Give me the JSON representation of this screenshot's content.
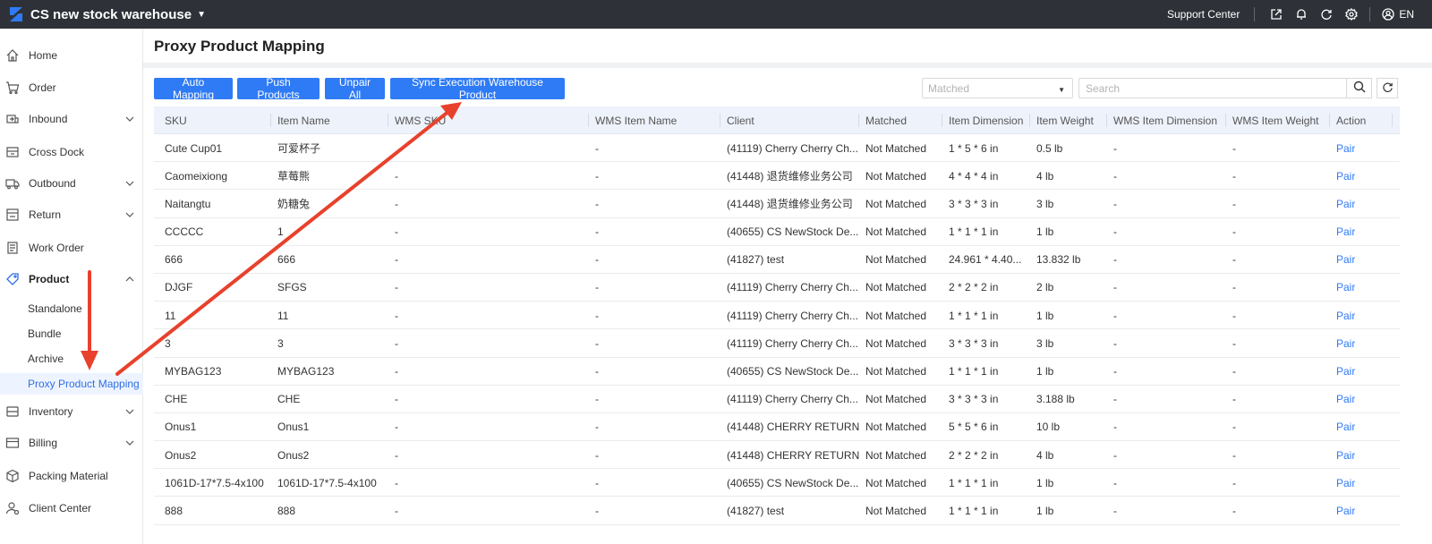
{
  "topbar": {
    "warehouse": "CS new stock warehouse",
    "support": "Support Center",
    "language": "EN",
    "icons": [
      "share-icon",
      "bell-icon",
      "refresh-icon",
      "settings-icon",
      "user-icon"
    ]
  },
  "sidebar": {
    "items": [
      {
        "label": "Home",
        "icon": "home-icon"
      },
      {
        "label": "Order",
        "icon": "cart-icon"
      },
      {
        "label": "Inbound",
        "icon": "inbound-icon"
      },
      {
        "label": "Cross Dock",
        "icon": "cross-dock-icon"
      },
      {
        "label": "Outbound",
        "icon": "truck-icon"
      },
      {
        "label": "Return",
        "icon": "return-icon"
      },
      {
        "label": "Work Order",
        "icon": "work-order-icon"
      },
      {
        "label": "Product",
        "icon": "tag-icon"
      },
      {
        "label": "Inventory",
        "icon": "inventory-icon"
      },
      {
        "label": "Billing",
        "icon": "billing-icon"
      },
      {
        "label": "Packing Material",
        "icon": "box-icon"
      },
      {
        "label": "Client Center",
        "icon": "client-icon"
      }
    ],
    "product_sub": [
      "Standalone",
      "Bundle",
      "Archive",
      "Proxy Product Mapping"
    ]
  },
  "page": {
    "title": "Proxy Product Mapping",
    "buttons": {
      "auto_mapping": "Auto Mapping",
      "push_products": "Push Products",
      "unpair_all": "Unpair All",
      "sync": "Sync Execution Warehouse Product"
    },
    "filter_placeholder": "Matched",
    "search_placeholder": "Search"
  },
  "table": {
    "columns": [
      "SKU",
      "Item Name",
      "WMS SKU",
      "WMS Item Name",
      "Client",
      "Matched",
      "Item Dimension",
      "Item Weight",
      "WMS Item Dimension",
      "WMS Item Weight",
      "Action"
    ],
    "rows": [
      [
        "Cute Cup01",
        "可爱杯子",
        "",
        "-",
        "(41119) Cherry Cherry Ch...",
        "Not Matched",
        "1 * 5 * 6 in",
        "0.5 lb",
        "-",
        "-",
        "Pair"
      ],
      [
        "Caomeixiong",
        "草莓熊",
        "-",
        "-",
        "(41448) 退货维修业务公司",
        "Not Matched",
        "4 * 4 * 4 in",
        "4 lb",
        "-",
        "-",
        "Pair"
      ],
      [
        "Naitangtu",
        "奶糖兔",
        "-",
        "-",
        "(41448) 退货维修业务公司",
        "Not Matched",
        "3 * 3 * 3 in",
        "3 lb",
        "-",
        "-",
        "Pair"
      ],
      [
        "CCCCC",
        "1",
        "-",
        "-",
        "(40655) CS NewStock De...",
        "Not Matched",
        "1 * 1 * 1 in",
        "1 lb",
        "-",
        "-",
        "Pair"
      ],
      [
        "666",
        "666",
        "-",
        "-",
        "(41827) test",
        "Not Matched",
        "24.961 * 4.40...",
        "13.832 lb",
        "-",
        "-",
        "Pair"
      ],
      [
        "DJGF",
        "SFGS",
        "-",
        "-",
        "(41119) Cherry Cherry Ch...",
        "Not Matched",
        "2 * 2 * 2 in",
        "2 lb",
        "-",
        "-",
        "Pair"
      ],
      [
        "11",
        "11",
        "-",
        "-",
        "(41119) Cherry Cherry Ch...",
        "Not Matched",
        "1 * 1 * 1 in",
        "1 lb",
        "-",
        "-",
        "Pair"
      ],
      [
        "3",
        "3",
        "-",
        "-",
        "(41119) Cherry Cherry Ch...",
        "Not Matched",
        "3 * 3 * 3 in",
        "3 lb",
        "-",
        "-",
        "Pair"
      ],
      [
        "MYBAG123",
        "MYBAG123",
        "-",
        "-",
        "(40655) CS NewStock De...",
        "Not Matched",
        "1 * 1 * 1 in",
        "1 lb",
        "-",
        "-",
        "Pair"
      ],
      [
        "CHE",
        "CHE",
        "-",
        "-",
        "(41119) Cherry Cherry Ch...",
        "Not Matched",
        "3 * 3 * 3 in",
        "3.188 lb",
        "-",
        "-",
        "Pair"
      ],
      [
        "Onus1",
        "Onus1",
        "-",
        "-",
        "(41448) CHERRY RETURN",
        "Not Matched",
        "5 * 5 * 6 in",
        "10 lb",
        "-",
        "-",
        "Pair"
      ],
      [
        "Onus2",
        "Onus2",
        "-",
        "-",
        "(41448) CHERRY RETURN",
        "Not Matched",
        "2 * 2 * 2 in",
        "4 lb",
        "-",
        "-",
        "Pair"
      ],
      [
        "1061D-17*7.5-4x100",
        "1061D-17*7.5-4x100",
        "-",
        "-",
        "(40655) CS NewStock De...",
        "Not Matched",
        "1 * 1 * 1 in",
        "1 lb",
        "-",
        "-",
        "Pair"
      ],
      [
        "888",
        "888",
        "-",
        "-",
        "(41827) test",
        "Not Matched",
        "1 * 1 * 1 in",
        "1 lb",
        "-",
        "-",
        "Pair"
      ]
    ]
  },
  "colors": {
    "topbar": "#2e3238",
    "primary": "#2f7bf5",
    "annotation": "#e8412c"
  }
}
